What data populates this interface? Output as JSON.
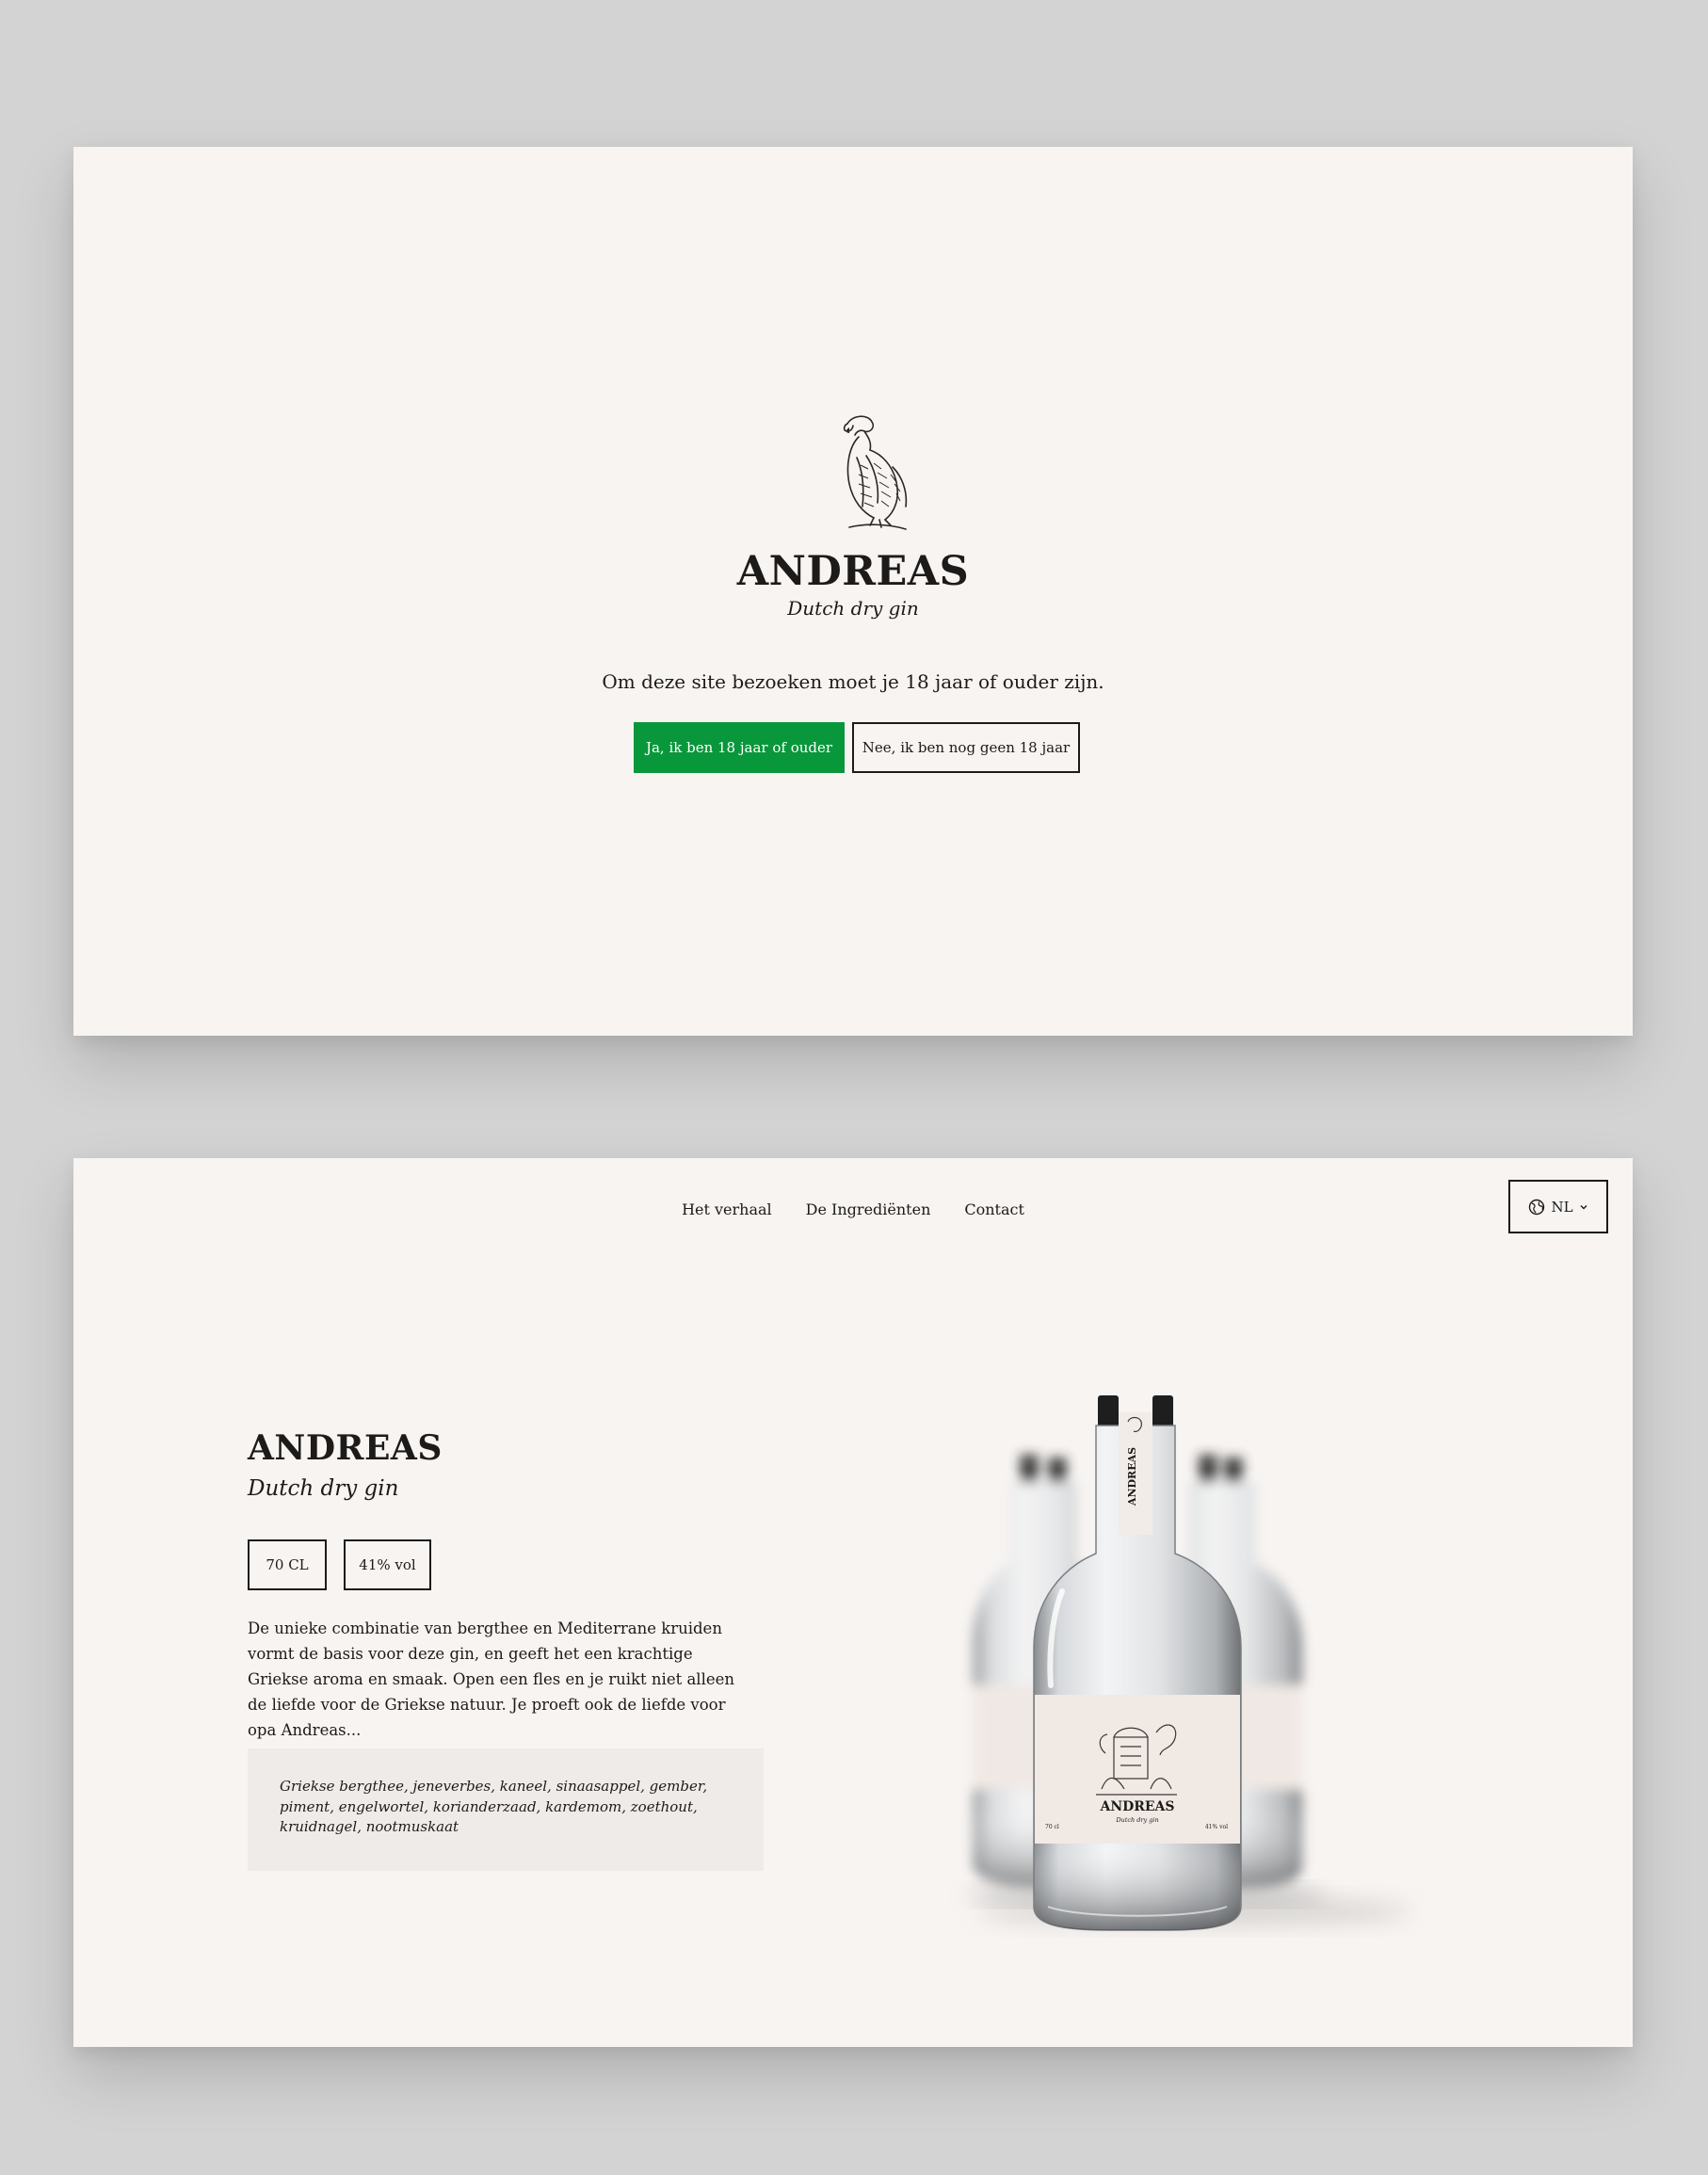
{
  "age_gate": {
    "brand": "ANDREAS",
    "tagline": "Dutch dry gin",
    "question": "Om deze site bezoeken moet je 18 jaar of ouder zijn.",
    "yes_label": "Ja, ik ben 18 jaar of ouder",
    "no_label": "Nee, ik ben nog geen 18 jaar",
    "logo_icon": "vulture-icon"
  },
  "home": {
    "nav": [
      "Het verhaal",
      "De Ingrediënten",
      "Contact"
    ],
    "language": {
      "current": "NL",
      "icon": "globe-icon"
    },
    "brand": "ANDREAS",
    "tagline": "Dutch dry gin",
    "specs": {
      "volume": "70 CL",
      "abv": "41% vol"
    },
    "description": "De unieke combinatie van bergthee en Mediterrane kruiden vormt de basis voor deze gin, en geeft het een krachtige Griekse aroma en smaak. Open een fles en je ruikt niet alleen de liefde voor de Griekse natuur. Je proeft ook de liefde voor opa Andreas...",
    "ingredients": "Griekse bergthee, jeneverbes, kaneel, sinaasappel, gember, piment, engelwortel, korianderzaad, kardemom, zoethout, kruidnagel, nootmuskaat",
    "bottle_label": {
      "neck": "ANDREAS",
      "brand": "ANDREAS",
      "subtitle": "Dutch dry gin",
      "left": "70 cl",
      "right": "41% vol"
    }
  },
  "colors": {
    "page_bg": "#d3d3d3",
    "panel_bg": "#f7f4f2",
    "text": "#1c1b19",
    "accent_green": "#08973b",
    "ingredients_bg": "#efebe9"
  }
}
